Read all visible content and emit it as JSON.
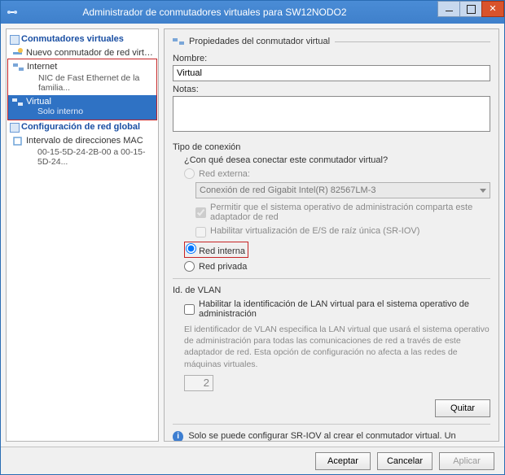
{
  "window": {
    "title": "Administrador de conmutadores virtuales para SW12NODO2"
  },
  "left": {
    "section1": "Conmutadores virtuales",
    "new_switch": "Nuevo conmutador de red virtual",
    "internet": "Internet",
    "internet_sub": "NIC de Fast Ethernet de la familia...",
    "virtual": "Virtual",
    "virtual_sub": "Solo interno",
    "section2": "Configuración de red global",
    "mac_range": "Intervalo de direcciones MAC",
    "mac_sub": "00-15-5D-24-2B-00 a 00-15-5D-24..."
  },
  "right": {
    "header": "Propiedades del conmutador virtual",
    "name_label": "Nombre:",
    "name_value": "Virtual",
    "notes_label": "Notas:",
    "notes_value": "",
    "conn_type_label": "Tipo de conexión",
    "conn_prompt": "¿Con qué desea conectar este conmutador virtual?",
    "ext_label": "Red externa:",
    "ext_adapter": "Conexión de red Gigabit Intel(R) 82567LM-3",
    "share_label": "Permitir que el sistema operativo de administración comparta este adaptador de red",
    "sriov_label": "Habilitar virtualización de E/S de raíz única (SR-IOV)",
    "int_label": "Red interna",
    "priv_label": "Red privada",
    "vlan_header": "Id. de VLAN",
    "vlan_enable": "Habilitar la identificación de LAN virtual para el sistema operativo de administración",
    "vlan_help": "El identificador de VLAN especifica la LAN virtual que usará el sistema operativo de administración para todas las comunicaciones de red a través de este adaptador de red. Esta opción de configuración no afecta a las redes de máquinas virtuales.",
    "vlan_id": "2",
    "remove": "Quitar",
    "info": "Solo se puede configurar SR-IOV al crear el conmutador virtual. Un conmutador"
  },
  "footer": {
    "ok": "Aceptar",
    "cancel": "Cancelar",
    "apply": "Aplicar"
  }
}
